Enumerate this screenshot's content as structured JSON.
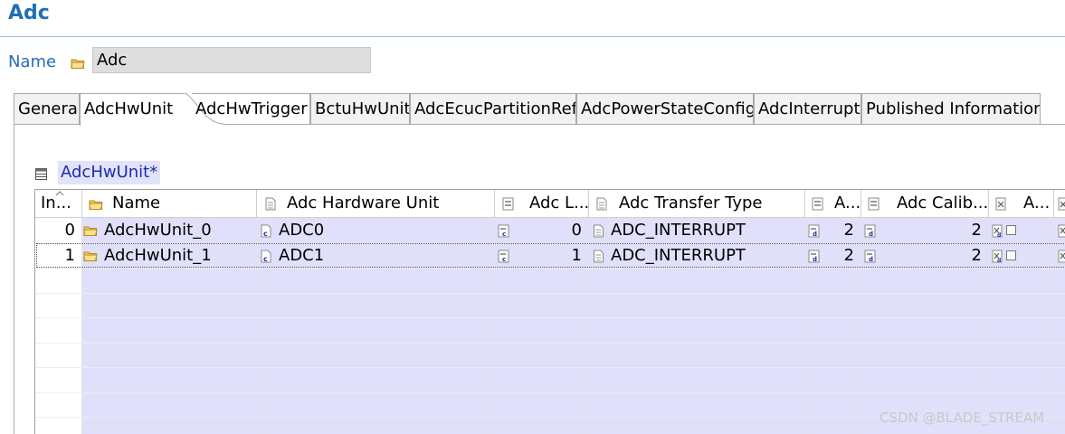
{
  "header": {
    "title": "Adc"
  },
  "name": {
    "label": "Name",
    "value": "Adc"
  },
  "tabs": [
    {
      "label": "General"
    },
    {
      "label": "AdcHwUnit"
    },
    {
      "label": "AdcHwTrigger"
    },
    {
      "label": "BctuHwUnit"
    },
    {
      "label": "AdcEcucPartitionRef"
    },
    {
      "label": "AdcPowerStateConfig"
    },
    {
      "label": "AdcInterrupt"
    },
    {
      "label": "Published Information"
    }
  ],
  "section": {
    "title": "AdcHwUnit*"
  },
  "table": {
    "columns": [
      {
        "label": "In..."
      },
      {
        "label": "Name"
      },
      {
        "label": "Adc Hardware Unit"
      },
      {
        "label": "Adc L..."
      },
      {
        "label": "Adc Transfer Type"
      },
      {
        "label": "A..."
      },
      {
        "label": "Adc Calib..."
      },
      {
        "label": "A..."
      }
    ],
    "rows": [
      {
        "index": "0",
        "name": "AdcHwUnit_0",
        "hw_unit": "ADC0",
        "adc_l": "0",
        "transfer_type": "ADC_INTERRUPT",
        "a1": "2",
        "calib": "2"
      },
      {
        "index": "1",
        "name": "AdcHwUnit_1",
        "hw_unit": "ADC1",
        "adc_l": "1",
        "transfer_type": "ADC_INTERRUPT",
        "a1": "2",
        "calib": "2"
      }
    ]
  },
  "watermark": "CSDN @BLADE_STREAM",
  "colors": {
    "accent": "#1f6fb8",
    "row_fill": "#e0e0fb",
    "section_text": "#1a2eb0"
  }
}
